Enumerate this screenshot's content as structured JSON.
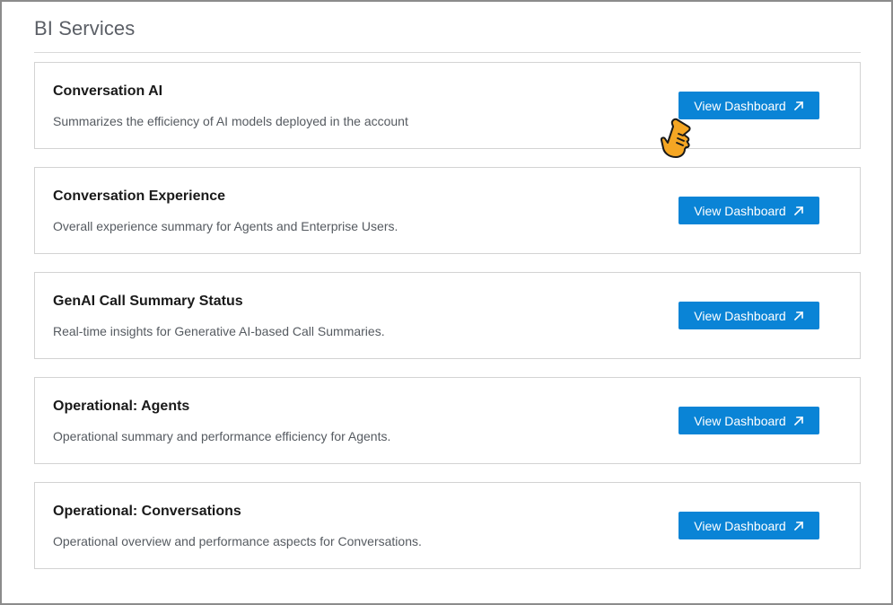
{
  "page": {
    "title": "BI Services"
  },
  "services": [
    {
      "title": "Conversation AI",
      "description": "Summarizes the efficiency of AI models deployed in the account",
      "button_label": "View Dashboard"
    },
    {
      "title": "Conversation Experience",
      "description": "Overall experience summary for Agents and Enterprise Users.",
      "button_label": "View Dashboard"
    },
    {
      "title": "GenAI Call Summary Status",
      "description": "Real-time insights for Generative AI-based Call Summaries.",
      "button_label": "View Dashboard"
    },
    {
      "title": "Operational: Agents",
      "description": "Operational summary and performance efficiency for Agents.",
      "button_label": "View Dashboard"
    },
    {
      "title": "Operational: Conversations",
      "description": "Operational overview and performance aspects for Conversations.",
      "button_label": "View Dashboard"
    }
  ],
  "icons": {
    "button_icon": "external-link-arrow-icon",
    "cursor": "hand-pointer-cursor-icon"
  },
  "colors": {
    "button_bg": "#0a84d6",
    "button_text": "#ffffff",
    "title_text": "#5b5f66",
    "card_border": "#d3d3d3",
    "cursor_fill": "#f5a623"
  }
}
